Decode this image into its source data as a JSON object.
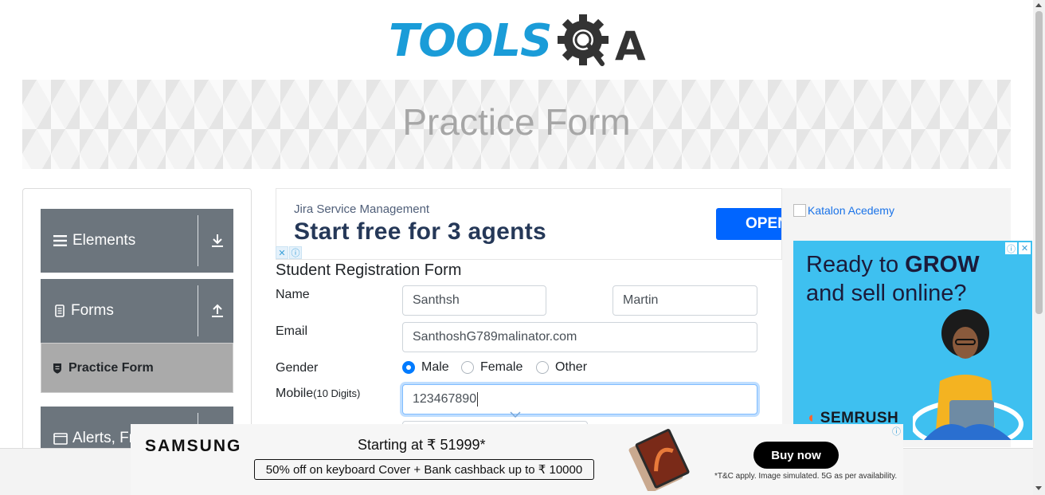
{
  "header": {
    "logo_text": "TOOLS",
    "logo_suffix": "A",
    "logo_icon": "gear-magnifier-icon"
  },
  "banner": {
    "title": "Practice Form"
  },
  "sidebar": {
    "groups": [
      {
        "label": "Elements",
        "icon": "hamburger-icon",
        "arrow": "download-arrow-icon"
      },
      {
        "label": "Forms",
        "icon": "document-icon",
        "arrow": "upload-arrow-icon"
      },
      {
        "label": "Alerts, Fr",
        "icon": "window-icon",
        "arrow": "download-arrow-icon"
      }
    ],
    "active_item": {
      "label": "Practice Form",
      "icon": "shield-icon"
    }
  },
  "ad_top": {
    "brand": "Jira Service Management",
    "headline": "Start free for 3 agents",
    "cta": "OPEN"
  },
  "form": {
    "title": "Student Registration Form",
    "name_label": "Name",
    "first_name": "Santhsh",
    "last_name": "Martin",
    "email_label": "Email",
    "email_value": "SanthoshG789malinator.com",
    "gender_label": "Gender",
    "gender_options": [
      "Male",
      "Female",
      "Other"
    ],
    "gender_selected": "Male",
    "mobile_label": "Mobile",
    "mobile_hint": "(10 Digits)",
    "mobile_value": "123467890"
  },
  "right_ad": {
    "katalon_alt": "Katalon Acedemy",
    "semrush_headline_1": "Ready to ",
    "semrush_headline_grow": "GROW",
    "semrush_headline_2": "and sell online?",
    "semrush_brand": "SEMRUSH"
  },
  "bottom_ad": {
    "brand": "SAMSUNG",
    "price": "Starting at ₹ 51999*",
    "offer": "50% off on keyboard Cover + Bank cashback up to ₹ 10000",
    "cta": "Buy now",
    "tnc": "*T&C apply. Image simulated. 5G as per availability."
  },
  "colors": {
    "logo_blue": "#1a9cd8",
    "sidebar_group": "#6c757d",
    "sidebar_active": "#aaaaaa",
    "radio_on": "#007bff",
    "jira_blue": "#0065ff",
    "semrush_bg": "#3ec0f0"
  }
}
